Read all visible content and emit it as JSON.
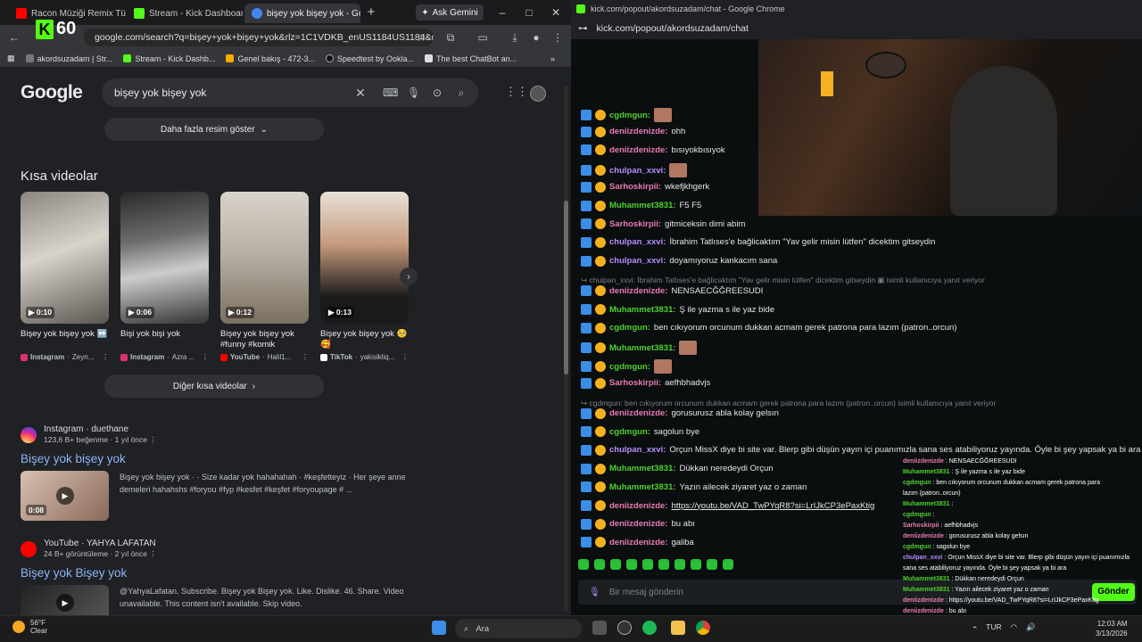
{
  "left_browser": {
    "tabs": [
      {
        "label": "Racon Müziği Remix Tü",
        "color": "#ff0000"
      },
      {
        "label": "Stream - Kick Dashboar",
        "color": "#53fc18"
      },
      {
        "label": "bişey yok bişey yok - Go",
        "color": "#4285f4"
      }
    ],
    "new_tab": "+",
    "ask_gemini": "Ask Gemini",
    "window_controls": {
      "minimize": "–",
      "maximize": "□",
      "close": "✕"
    },
    "overlay_count": "60",
    "url": "google.com/search?q=bişey+yok+bişey+yok&rlz=1C1VDKB_enUS1184US1184&oq...",
    "bookmarks": [
      "akordsuzadam | Str...",
      "Stream - Kick Dashb...",
      "Genel bakış - 472-3...",
      "Speedtest by Ookla...",
      "The best ChatBot an..."
    ],
    "google_logo": "Google",
    "search_query": "bişey yok bişey yok",
    "more_images": "Daha fazla resim göster",
    "short_videos_title": "Kısa videolar",
    "videos": [
      {
        "duration": "0:10",
        "title": "Bişey yok bişey yok ↔️",
        "source": "Instagram",
        "author": "Zeyn...",
        "color": "#e1306c"
      },
      {
        "duration": "0:06",
        "title": "Bişi yok bişi yok",
        "source": "Instagram",
        "author": "Azra ...",
        "color": "#e1306c"
      },
      {
        "duration": "0:12",
        "title": "Bişey yok bişey yok #funny #komik",
        "source": "YouTube",
        "author": "Halil1...",
        "color": "#ff0000"
      },
      {
        "duration": "0:13",
        "title": "Bişey yok bişey yok 🥺🥰",
        "source": "TikTok",
        "author": "yakisikliq...",
        "color": "#ffffff"
      }
    ],
    "more_short_videos": "Diğer kısa videolar",
    "results": [
      {
        "site": "Instagram · duethane",
        "meta": "123,6 B+ beğenme · 1 yıl önce",
        "title": "Bişey yok bişey yok",
        "snippet": "Bişey yok bişey yok · · Size kadar yok hahahahah · #keşfetteyiz · Her şeye anne demeleri hahahshs #foryou #fyp #kesfet #keşfet #foryoupage # ...",
        "duration": "0:08"
      },
      {
        "site": "YouTube · YAHYA LAFATAN",
        "meta": "24 B+ görüntüleme · 2 yıl önce",
        "title": "Bişey yok Bişey yok",
        "snippet": "@YahyaLafatan. Subscribe. Bişey yok Bişey yok. Like. Dislike. 46. Share. Video unavailable. This content isn't available. Skip video."
      }
    ]
  },
  "right_browser": {
    "title": "kick.com/popout/akordsuzadam/chat - Google Chrome",
    "url": "kick.com/popout/akordsuzadam/chat",
    "messages": [
      {
        "user": "cgdmgun",
        "color": "#4ed12e",
        "text": ""
      },
      {
        "user": "deniizdenizde",
        "color": "#e97bb5",
        "text": "ohh"
      },
      {
        "user": "deniizdenizde",
        "color": "#e97bb5",
        "text": "bısıyokbısıyok"
      },
      {
        "user": "chulpan_xxvi",
        "color": "#b78cff",
        "text": ""
      },
      {
        "user": "Sarhoskirpii",
        "color": "#e97bb5",
        "text": "wkefjkhgerk"
      },
      {
        "user": "Muhammet3831",
        "color": "#4ed12e",
        "text": "F5 F5"
      },
      {
        "user": "Sarhoskirpii",
        "color": "#e97bb5",
        "text": "gitmiceksin dimi abim"
      },
      {
        "user": "chulpan_xxvi",
        "color": "#b78cff",
        "text": "İbrahim Tatlıses'e bağlicaktım \"Yav gelir misin lütfen\" dicektim gitseydin"
      },
      {
        "user": "chulpan_xxvi",
        "color": "#b78cff",
        "text": "doyamıyoruz kankacım sana"
      },
      {
        "reply": "↪ chulpan_xxvi: İbrahim Tatlıses'e bağlicaktım \"Yav gelir misin lütfen\" dicektim gitseydin ▣ isimli kullanıcıya yanıt veriyor"
      },
      {
        "user": "deniizdenizde",
        "color": "#e97bb5",
        "text": "NENSAECĞĞREESUDI"
      },
      {
        "user": "Muhammet3831",
        "color": "#4ed12e",
        "text": "Ş ile yazma s ile yaz bide"
      },
      {
        "user": "cgdmgun",
        "color": "#4ed12e",
        "text": "ben cıkıyorum orcunum dukkan acmam gerek patrona para lazım (patron..orcun)"
      },
      {
        "user": "Muhammet3831",
        "color": "#4ed12e",
        "text": ""
      },
      {
        "user": "cgdmgun",
        "color": "#4ed12e",
        "text": ""
      },
      {
        "user": "Sarhoskirpii",
        "color": "#e97bb5",
        "text": "aefhbhadvjs"
      },
      {
        "reply": "↪ cgdmgun: ben cıkıyorum orcunum dukkan acmam gerek patrona para lazım (patron..orcun) isimli kullanıcıya yanıt veriyor"
      },
      {
        "user": "deniizdenizde",
        "color": "#e97bb5",
        "text": "gorusurusz abla kolay gelsın"
      },
      {
        "user": "cgdmgun",
        "color": "#4ed12e",
        "text": "sagolun bye"
      },
      {
        "user": "chulpan_xxvi",
        "color": "#b78cff",
        "text": "Orçun MissX diye bi site var. Blerp gibi düşün yayın içi puanımızla sana ses atabiliyoruz yayında. Öyle bi şey yapsak ya bi ara"
      },
      {
        "user": "Muhammet3831",
        "color": "#4ed12e",
        "text": "Dükkan neredeydi Orçun"
      },
      {
        "user": "Muhammet3831",
        "color": "#4ed12e",
        "text": "Yazın ailecek ziyaret yaz o zaman"
      },
      {
        "user": "deniizdenizde",
        "color": "#e97bb5",
        "text": "https://youtu.be/VAD_TwPYqR8?si=LrIJkCP3ePaxKtig"
      },
      {
        "user": "deniizdenizde",
        "color": "#e97bb5",
        "text": "bu abı"
      },
      {
        "user": "deniizdenizde",
        "color": "#e97bb5",
        "text": "galiba"
      }
    ],
    "input_placeholder": "Bir mesaj gönderin",
    "send": "Gönder",
    "overlay": [
      {
        "user": "deniizdenizde",
        "color": "#e97bb5",
        "text": "NENSAECĞĞREESUDI"
      },
      {
        "user": "Muhammet3831",
        "color": "#4ed12e",
        "text": "Ş ile yazma s ile yaz bide"
      },
      {
        "user": "cgdmgun",
        "color": "#4ed12e",
        "text": "ben cıkıyorum orcunum dukkan acmam gerek patrona para"
      },
      {
        "user": "",
        "color": "#fff",
        "text": "lazım (patron..orcun)"
      },
      {
        "user": "Muhammet3831",
        "color": "#4ed12e",
        "text": ""
      },
      {
        "user": "cgdmgun",
        "color": "#4ed12e",
        "text": ""
      },
      {
        "user": "Sarhoskirpii",
        "color": "#e97bb5",
        "text": "aefhbhadvjs"
      },
      {
        "user": "deniizdenizde",
        "color": "#e97bb5",
        "text": "gorusurusz abla kolay gelsın"
      },
      {
        "user": "cgdmgun",
        "color": "#4ed12e",
        "text": "sagolun bye"
      },
      {
        "user": "chulpan_xxvi",
        "color": "#b78cff",
        "text": "Orçun MissX diye bi site var. Blerp gibi düşün yayın içi puanımızla"
      },
      {
        "user": "",
        "color": "#fff",
        "text": "sana ses atabiliyoruz yayında. Öyle bi şey yapsak ya bi ara"
      },
      {
        "user": "Muhammet3831",
        "color": "#4ed12e",
        "text": "Dükkan neredeydi Orçun"
      },
      {
        "user": "Muhammet3831",
        "color": "#4ed12e",
        "text": "Yazın ailecek ziyaret yaz o zaman"
      },
      {
        "user": "deniizdenizde",
        "color": "#e97bb5",
        "text": "https://youtu.be/VAD_TwPYqR8?si=LrIJkCP3ePaxKtig"
      },
      {
        "user": "deniizdenizde",
        "color": "#e97bb5",
        "text": "bu abı"
      },
      {
        "user": "deniizdenizde",
        "color": "#e97bb5",
        "text": "galiba"
      }
    ]
  },
  "taskbar": {
    "weather_temp": "56°F",
    "weather_desc": "Clear",
    "search": "Ara",
    "lang": "TUR",
    "time": "12:03 AM",
    "date": "3/13/2026"
  }
}
